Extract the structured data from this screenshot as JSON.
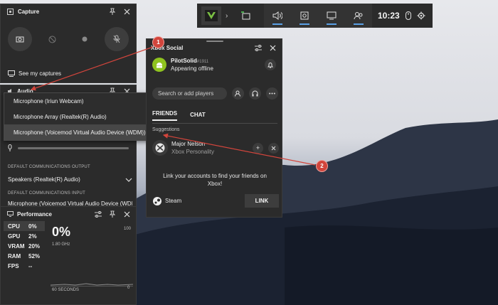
{
  "capture": {
    "title": "Capture",
    "see_captures": "See my captures"
  },
  "audio": {
    "title": "Audio",
    "menu_items": [
      "Microphone (Iriun Webcam)",
      "Microphone Array (Realtek(R) Audio)",
      "Microphone (Voicemod Virtual Audio Device (WDM))"
    ],
    "output_label": "DEFAULT COMMUNICATIONS OUTPUT",
    "output_device": "Speakers (Realtek(R) Audio)",
    "input_label": "DEFAULT COMMUNICATIONS INPUT",
    "input_device": "Microphone (Voicemod Virtual Audio Device (WDM))"
  },
  "performance": {
    "title": "Performance",
    "metrics": [
      {
        "label": "CPU",
        "value": "0%"
      },
      {
        "label": "GPU",
        "value": "2%"
      },
      {
        "label": "VRAM",
        "value": "20%"
      },
      {
        "label": "RAM",
        "value": "52%"
      },
      {
        "label": "FPS",
        "value": "--"
      }
    ],
    "big_value": "0%",
    "clock": "1.80 GHz",
    "max": "100",
    "window": "60 SECONDS",
    "min": "0"
  },
  "social": {
    "title": "Xbox Social",
    "profile_name": "PilotSolid",
    "profile_tag": "#1911",
    "profile_status": "Appearing offline",
    "search_placeholder": "Search or add players",
    "tabs": [
      "FRIENDS",
      "CHAT"
    ],
    "section_label": "Suggestions",
    "friend_name": "Major Nelson",
    "friend_sub": "Xbox Personality",
    "link_text": "Link your accounts to find your friends on Xbox!",
    "steam_label": "Steam",
    "link_button": "LINK"
  },
  "gamebar": {
    "time": "10:23"
  },
  "annotations": [
    "1",
    "2"
  ],
  "colors": {
    "panel": "#2b2b2b",
    "accent": "#5aa0e6",
    "annotation": "#d2453c",
    "avatar": "#8fc31f"
  }
}
